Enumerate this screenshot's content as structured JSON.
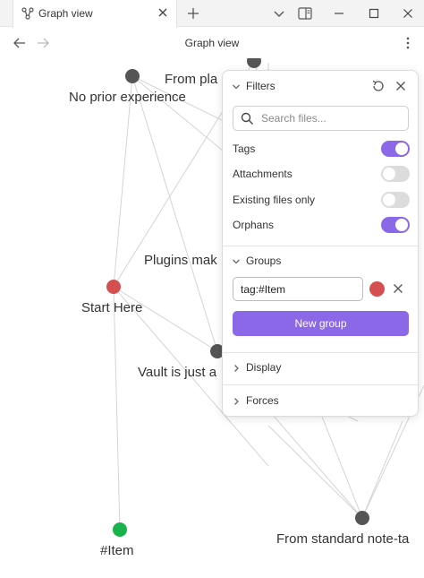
{
  "tab": {
    "title": "Graph view",
    "icon": "graph-icon"
  },
  "nav": {
    "title": "Graph view"
  },
  "colors": {
    "accent": "#8b68e8",
    "node_default": "#555555",
    "node_red": "#d45050",
    "node_green": "#19b34b",
    "edge": "#d2d2d2"
  },
  "graph": {
    "labels": {
      "from_pla": "From pla",
      "no_prior": "No prior experience",
      "plugins_mak": "Plugins mak",
      "start_here": "Start Here",
      "vault": "Vault is just a",
      "item": "#Item",
      "from_standard": "From standard note-ta"
    }
  },
  "filters": {
    "title": "Filters",
    "search_placeholder": "Search files...",
    "options": [
      {
        "label": "Tags",
        "enabled": true
      },
      {
        "label": "Attachments",
        "enabled": false
      },
      {
        "label": "Existing files only",
        "enabled": false
      },
      {
        "label": "Orphans",
        "enabled": true
      }
    ]
  },
  "groups": {
    "title": "Groups",
    "query": "tag:#Item",
    "color": "#d45050",
    "new_group_label": "New group"
  },
  "display": {
    "title": "Display"
  },
  "forces": {
    "title": "Forces"
  }
}
